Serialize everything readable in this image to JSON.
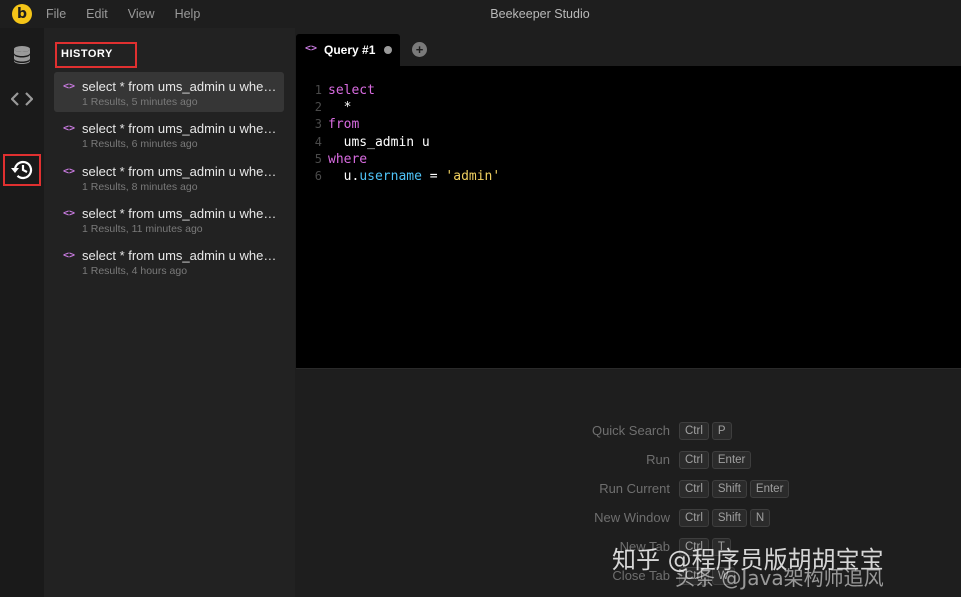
{
  "app": {
    "logo_letter": "b",
    "title": "Beekeeper Studio"
  },
  "menu": [
    "File",
    "Edit",
    "View",
    "Help"
  ],
  "activity_bar": {
    "icons": [
      "database-icon",
      "code-icon",
      "history-icon"
    ],
    "active": "history-icon"
  },
  "sidebar": {
    "header": "HISTORY",
    "items": [
      {
        "query": "select * from ums_admin u where u.username = 'admin'",
        "meta": "1 Results, 5 minutes ago",
        "active": true
      },
      {
        "query": "select * from ums_admin u where u.username = 'admin'",
        "meta": "1 Results, 6 minutes ago",
        "active": false
      },
      {
        "query": "select * from ums_admin u where u.username = 'admin'",
        "meta": "1 Results, 8 minutes ago",
        "active": false
      },
      {
        "query": "select * from ums_admin u where u.username = 'admin'",
        "meta": "1 Results, 11 minutes ago",
        "active": false
      },
      {
        "query": "select * from ums_admin u where u.username = 'admin'",
        "meta": "1 Results, 4 hours ago",
        "active": false
      }
    ]
  },
  "tabs": [
    {
      "icon": "<>",
      "label": "Query #1",
      "unsaved": true
    }
  ],
  "editor": {
    "lines": [
      {
        "num": "1",
        "tokens": [
          {
            "t": "select",
            "c": "kw"
          }
        ]
      },
      {
        "num": "2",
        "tokens": [
          {
            "t": "  *",
            "c": ""
          }
        ]
      },
      {
        "num": "3",
        "tokens": [
          {
            "t": "from",
            "c": "kw"
          }
        ]
      },
      {
        "num": "4",
        "tokens": [
          {
            "t": "  ums_admin u",
            "c": ""
          }
        ]
      },
      {
        "num": "5",
        "tokens": [
          {
            "t": "where",
            "c": "kw"
          }
        ]
      },
      {
        "num": "6",
        "tokens": [
          {
            "t": "  u",
            "c": ""
          },
          {
            "t": ".",
            "c": ""
          },
          {
            "t": "username",
            "c": "field"
          },
          {
            "t": " = ",
            "c": ""
          },
          {
            "t": "'admin'",
            "c": "str"
          }
        ]
      }
    ]
  },
  "shortcuts": [
    {
      "label": "Quick Search",
      "keys": [
        "Ctrl",
        "P"
      ]
    },
    {
      "label": "Run",
      "keys": [
        "Ctrl",
        "Enter"
      ]
    },
    {
      "label": "Run Current",
      "keys": [
        "Ctrl",
        "Shift",
        "Enter"
      ]
    },
    {
      "label": "New Window",
      "keys": [
        "Ctrl",
        "Shift",
        "N"
      ]
    },
    {
      "label": "New Tab",
      "keys": [
        "Ctrl",
        "T"
      ]
    },
    {
      "label": "Close Tab",
      "keys": [
        "Ctrl",
        "W"
      ]
    }
  ],
  "watermark": {
    "line1": "知乎 @程序员版胡胡宝宝",
    "line2": "头条 @Java架构师追风"
  },
  "colors": {
    "accent_pink": "#d86be0",
    "string_yellow": "#f0d060",
    "field_blue": "#4fc3f7",
    "highlight_red": "#e03030",
    "logo_yellow": "#f5c518"
  }
}
